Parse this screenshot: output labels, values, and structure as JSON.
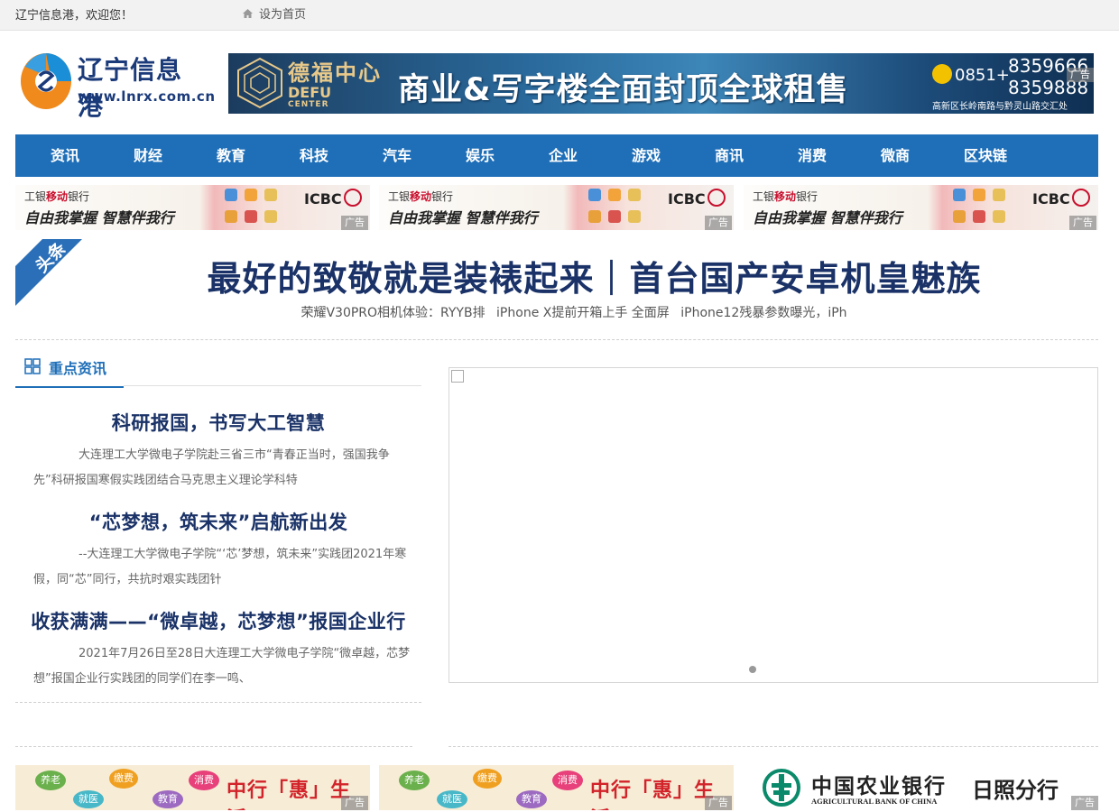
{
  "topbar": {
    "welcome": "辽宁信息港，欢迎您！",
    "set_home": "设为首页",
    "home_icon": "home-icon"
  },
  "logo": {
    "brand": "辽宁信息港",
    "url": "www.lnrx.com.cn"
  },
  "top_banner": {
    "name_cn": "德福中心",
    "name_en": "DEFU",
    "name_en2": "CENTER",
    "slogan": "商业&写字楼全面封顶全球租售",
    "tel_prefix": "0851+",
    "tel_1": "8359666",
    "tel_2": "8359888",
    "address": "高新区长岭南路与黔灵山路交汇处",
    "ad_tag": "广告"
  },
  "nav": {
    "items": [
      "资讯",
      "财经",
      "教育",
      "科技",
      "汽车",
      "娱乐",
      "企业",
      "游戏",
      "商讯",
      "消费",
      "微商",
      "区块链"
    ]
  },
  "icbc_ads": [
    {
      "brand_prefix": "工银",
      "brand_highlight": "移动",
      "brand_suffix": "银行",
      "slogan": "自由我掌握  智慧伴我行",
      "logo": "ICBC",
      "ad_tag": "广告"
    },
    {
      "brand_prefix": "工银",
      "brand_highlight": "移动",
      "brand_suffix": "银行",
      "slogan": "自由我掌握  智慧伴我行",
      "logo": "ICBC",
      "ad_tag": "广告"
    },
    {
      "brand_prefix": "工银",
      "brand_highlight": "移动",
      "brand_suffix": "银行",
      "slogan": "自由我掌握  智慧伴我行",
      "logo": "ICBC",
      "ad_tag": "广告"
    }
  ],
  "headline": {
    "tag": "头条",
    "title": "最好的致敬就是装裱起来｜首台国产安卓机皇魅族",
    "subs": [
      "荣耀V30PRO相机体验：RYYB排",
      "iPhone X提前开箱上手 全面屏",
      "iPhone12残暴参数曝光，iPh"
    ]
  },
  "section": {
    "title": "重点资讯",
    "icon": "grid-icon"
  },
  "articles": [
    {
      "title": "科研报国，书写大工智慧",
      "desc": "大连理工大学微电子学院赴三省三市“青春正当时，强国我争先”科研报国寒假实践团结合马克思主义理论学科特"
    },
    {
      "title": "“芯梦想，筑未来”启航新出发",
      "desc": "--大连理工大学微电子学院“‘芯’梦想，筑未来”实践团2021年寒假，同“芯”同行，共抗时艰实践团针"
    },
    {
      "title": "收获满满——“微卓越，芯梦想”报国企业行",
      "desc": "2021年7月26日至28日大连理工大学微电子学院“微卓越，芯梦想”报国企业行实践团的同学们在李一鸣、"
    }
  ],
  "boc_ads": [
    {
      "slogan": "中行「惠」生活",
      "bubbles": [
        "养老",
        "缴费",
        "消费",
        "就医",
        "教育"
      ],
      "ad_tag": "广告"
    },
    {
      "slogan": "中行「惠」生活",
      "bubbles": [
        "养老",
        "缴费",
        "消费",
        "就医",
        "教育"
      ],
      "ad_tag": "广告"
    }
  ],
  "abc_ad": {
    "name_cn": "中国农业银行",
    "name_en": "AGRICULTURAL BANK OF CHINA",
    "branch": "日照分行",
    "ad_tag": "广告"
  },
  "colors": {
    "nav_bg": "#1f6fb8",
    "headline": "#1a3267",
    "accent": "#1f6fb8"
  }
}
